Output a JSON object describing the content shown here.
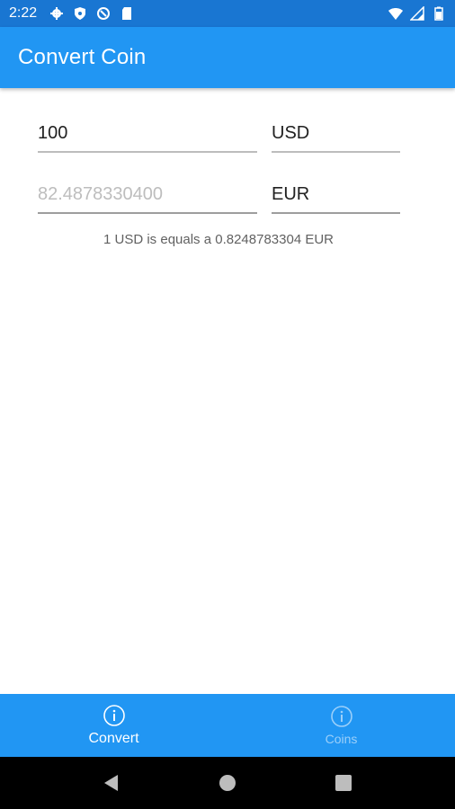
{
  "status_bar": {
    "time": "2:22",
    "icons_left": [
      "gear-icon",
      "shield-icon",
      "sync-icon",
      "sd-card-icon"
    ],
    "icons_right": [
      "wifi-icon",
      "signal-icon",
      "battery-icon"
    ]
  },
  "app_bar": {
    "title": "Convert Coin"
  },
  "converter": {
    "amount_value": "100",
    "from_currency": "USD",
    "result_value": "82.4878330400",
    "to_currency": "EUR",
    "rate_text": "1 USD is equals a 0.8248783304 EUR"
  },
  "tabs": [
    {
      "label": "Convert",
      "icon": "info-icon",
      "active": true
    },
    {
      "label": "Coins",
      "icon": "info-icon",
      "active": false
    }
  ],
  "nav_bar": {
    "buttons": [
      "back-icon",
      "home-icon",
      "recents-icon"
    ]
  },
  "colors": {
    "status_bar": "#1976d2",
    "primary": "#2196f3",
    "nav_bar": "#000000"
  }
}
